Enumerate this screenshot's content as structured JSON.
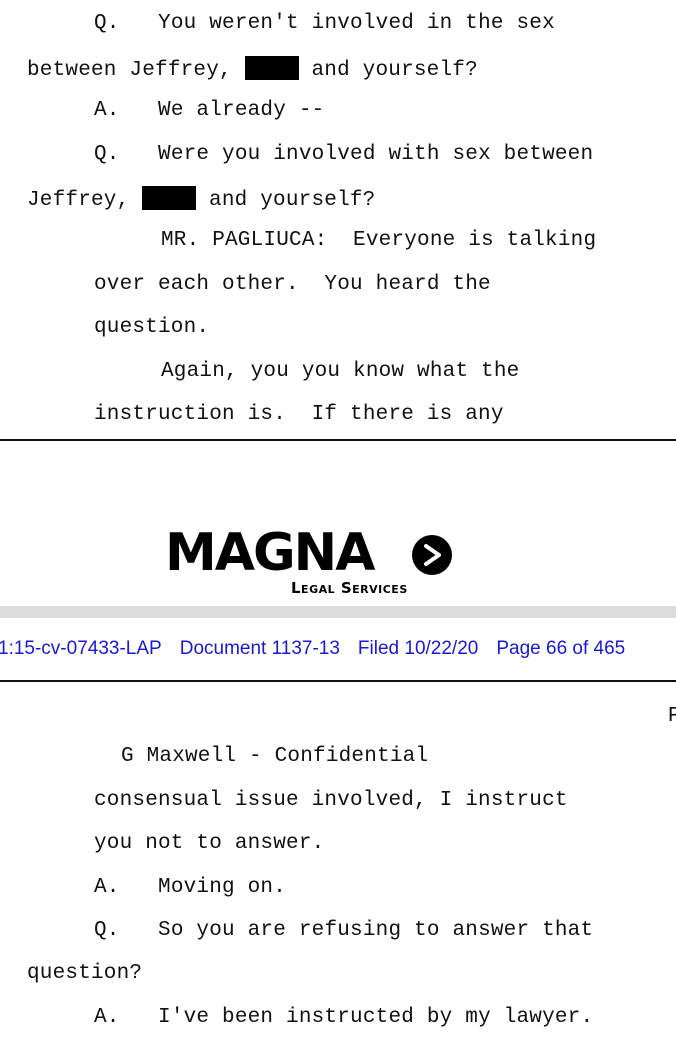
{
  "transcript_top": {
    "lines": [
      {
        "label": "Q.",
        "text": "You weren't involved in the sex"
      },
      {
        "pre": "between Jeffrey,",
        "post": "and yourself?"
      },
      {
        "label": "A.",
        "text": "We already --"
      },
      {
        "label": "Q.",
        "text": "Were you involved with sex between"
      },
      {
        "pre": "Jeffrey,",
        "post": "and yourself?"
      },
      {
        "text": "MR. PAGLIUCA:  Everyone is talking"
      },
      {
        "text": "over each other.  You heard the"
      },
      {
        "text": "question."
      },
      {
        "text": "Again, you you know what the"
      },
      {
        "text": "instruction is.  If there is any"
      }
    ]
  },
  "logo": {
    "name": "MAGNA",
    "subtitle": "Legal Services",
    "icon": "chevron-right-circle-icon"
  },
  "filing_header": {
    "case": "1:15-cv-07433-LAP",
    "document": "Document 1137-13",
    "filed": "Filed 10/22/20",
    "page": "Page 66 of 465",
    "color": "#1a1acc"
  },
  "transcript_bottom": {
    "corner_fragment": "P",
    "header": "G Maxwell - Confidential",
    "lines": [
      {
        "text": "consensual issue involved, I instruct"
      },
      {
        "text": "you not to answer."
      },
      {
        "label": "A.",
        "text": "Moving on."
      },
      {
        "label": "Q.",
        "text": "So you are refusing to answer that"
      },
      {
        "text": "question?"
      },
      {
        "label": "A.",
        "text": "I've been instructed by my lawyer."
      }
    ]
  }
}
